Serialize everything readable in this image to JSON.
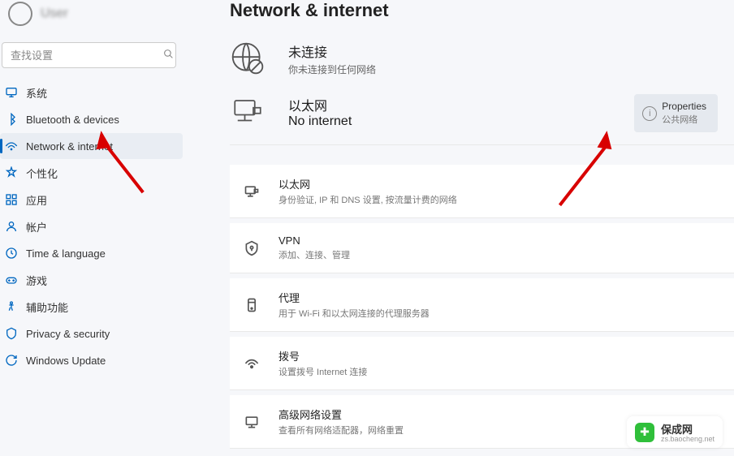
{
  "user_name": "User",
  "search_placeholder": "查找设置",
  "sidebar": [
    {
      "icon": "system",
      "label": "系统",
      "sel": false
    },
    {
      "icon": "bluetooth",
      "label": "Bluetooth & devices",
      "sel": false
    },
    {
      "icon": "network",
      "label": "Network & internet",
      "sel": true
    },
    {
      "icon": "personal",
      "label": "个性化",
      "sel": false
    },
    {
      "icon": "apps",
      "label": "应用",
      "sel": false
    },
    {
      "icon": "accounts",
      "label": "帐户",
      "sel": false
    },
    {
      "icon": "time",
      "label": "Time & language",
      "sel": false
    },
    {
      "icon": "gaming",
      "label": "游戏",
      "sel": false
    },
    {
      "icon": "access",
      "label": "辅助功能",
      "sel": false
    },
    {
      "icon": "privacy",
      "label": "Privacy & security",
      "sel": false
    },
    {
      "icon": "update",
      "label": "Windows Update",
      "sel": false
    }
  ],
  "page_title": "Network & internet",
  "status": {
    "title": "未连接",
    "sub": "你未连接到任何网络"
  },
  "ethernet": {
    "title": "以太网",
    "sub": "No internet"
  },
  "properties": {
    "title": "Properties",
    "sub": "公共网络"
  },
  "cards": [
    {
      "icon": "eth",
      "title": "以太网",
      "sub": "身份验证, IP 和 DNS 设置, 按流量计费的网络"
    },
    {
      "icon": "vpn",
      "title": "VPN",
      "sub": "添加、连接、管理"
    },
    {
      "icon": "proxy",
      "title": "代理",
      "sub": "用于 Wi-Fi 和以太网连接的代理服务器"
    },
    {
      "icon": "dial",
      "title": "拨号",
      "sub": "设置拨号 Internet 连接"
    },
    {
      "icon": "adv",
      "title": "高级网络设置",
      "sub": "查看所有网络适配器，网络重置"
    }
  ],
  "watermark": {
    "name": "保成网",
    "url": "zs.baocheng.net"
  }
}
